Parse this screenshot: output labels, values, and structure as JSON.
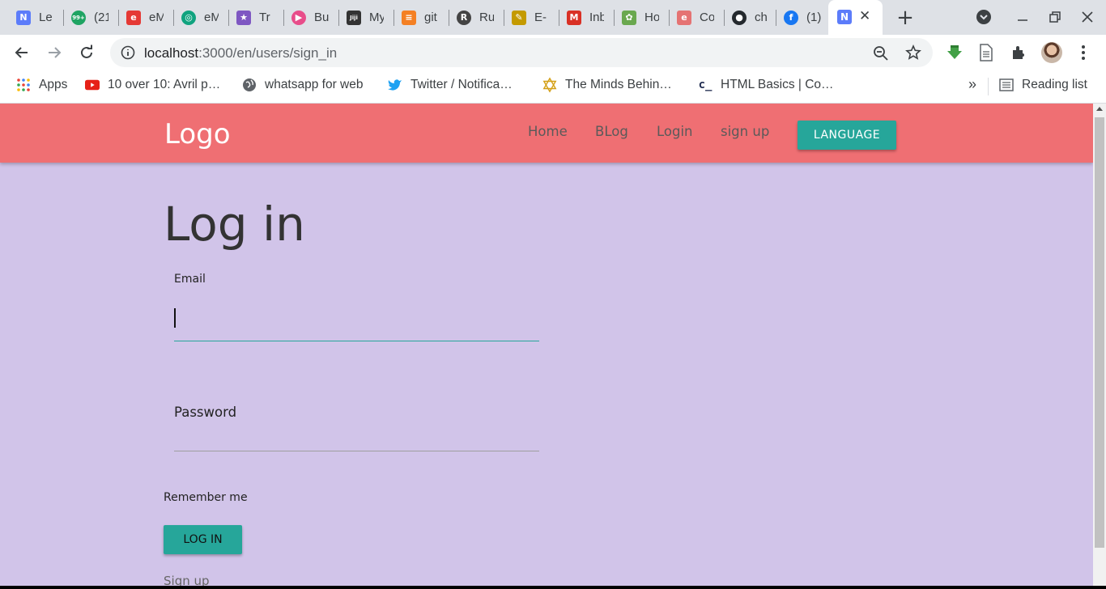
{
  "tabs": [
    {
      "title": "Le",
      "icon": "noteflight-icon",
      "color": "#5c7cfa",
      "glyph": "N"
    },
    {
      "title": "(21",
      "icon": "badge-99-icon",
      "color": "#1fa463",
      "glyph": "99+"
    },
    {
      "title": "eM",
      "icon": "e-icon",
      "color": "#e53935",
      "glyph": "e"
    },
    {
      "title": "eM",
      "icon": "openai-icon",
      "color": "#10a37f",
      "glyph": "◎"
    },
    {
      "title": "Tr",
      "icon": "star-icon",
      "color": "#7e57c2",
      "glyph": "★"
    },
    {
      "title": "Bu",
      "icon": "play-icon",
      "color": "#e84d8a",
      "glyph": "▶"
    },
    {
      "title": "My",
      "icon": "jiji-icon",
      "color": "#333333",
      "glyph": "Jiji"
    },
    {
      "title": "git",
      "icon": "stackoverflow-icon",
      "color": "#f48024",
      "glyph": "≡"
    },
    {
      "title": "Ru",
      "icon": "rust-icon",
      "color": "#444444",
      "glyph": "R"
    },
    {
      "title": "E-",
      "icon": "broom-icon",
      "color": "#c49a00",
      "glyph": "✎"
    },
    {
      "title": "Inb",
      "icon": "gmail-icon",
      "color": "#d93025",
      "glyph": "M"
    },
    {
      "title": "Ho",
      "icon": "plant-icon",
      "color": "#6aa84f",
      "glyph": "✿"
    },
    {
      "title": "Co",
      "icon": "e-icon",
      "color": "#e57373",
      "glyph": "e"
    },
    {
      "title": "ch",
      "icon": "github-icon",
      "color": "#24292e",
      "glyph": "●"
    },
    {
      "title": "(1)",
      "icon": "facebook-icon",
      "color": "#1877f2",
      "glyph": "f"
    }
  ],
  "active_tab": {
    "icon": "noteflight-icon",
    "glyph": "N",
    "close": "✕"
  },
  "new_tab": "+",
  "address": {
    "host": "localhost",
    "path": ":3000/en/users/sign_in"
  },
  "bookmarks": [
    {
      "label": "Apps",
      "icon": "apps-grid-icon"
    },
    {
      "label": "10 over 10: Avril p…",
      "icon": "youtube-icon"
    },
    {
      "label": "whatsapp for web",
      "icon": "globe-icon"
    },
    {
      "label": "Twitter / Notifica…",
      "icon": "twitter-icon"
    },
    {
      "label": "The Minds Behin…",
      "icon": "star-of-david-icon"
    },
    {
      "label": "HTML Basics | Co…",
      "icon": "codecademy-icon"
    }
  ],
  "bookmarks_overflow": "»",
  "reading_list": "Reading list",
  "site": {
    "logo": "Logo",
    "nav": [
      "Home",
      "BLog",
      "Login",
      "sign up"
    ],
    "language_button": "LANGUAGE"
  },
  "form": {
    "heading": "Log in",
    "email_label": "Email",
    "password_label": "Password",
    "remember_label": "Remember me",
    "submit": "LOG IN",
    "signup_link": "Sign up"
  },
  "colors": {
    "navbar": "#ef6f73",
    "page_bg": "#d1c4e9",
    "accent": "#26a69a"
  }
}
